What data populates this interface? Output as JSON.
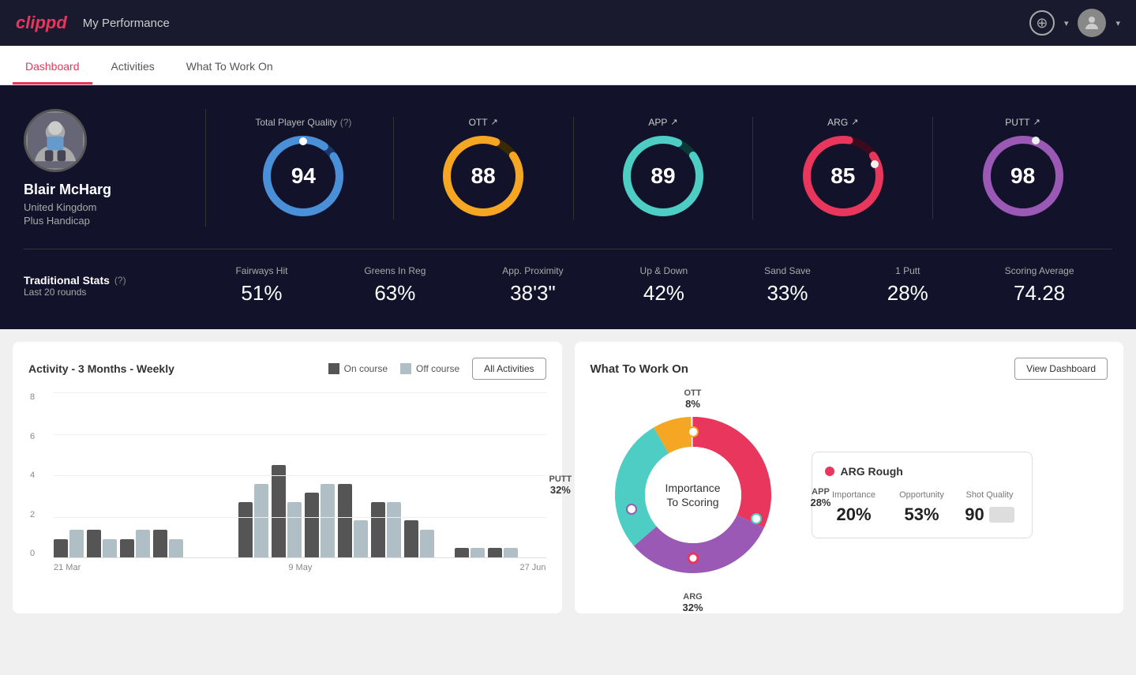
{
  "header": {
    "logo": "clippd",
    "title": "My Performance",
    "add_icon": "+",
    "chevron": "▾"
  },
  "nav": {
    "tabs": [
      {
        "label": "Dashboard",
        "active": true
      },
      {
        "label": "Activities",
        "active": false
      },
      {
        "label": "What To Work On",
        "active": false
      }
    ]
  },
  "player": {
    "name": "Blair McHarg",
    "country": "United Kingdom",
    "handicap": "Plus Handicap"
  },
  "tpq": {
    "label": "Total Player Quality",
    "value": 94,
    "color_start": "#4a90d9",
    "color_end": "#1e5fb5"
  },
  "metrics": [
    {
      "label": "OTT",
      "value": 88,
      "color": "#f5a623"
    },
    {
      "label": "APP",
      "value": 89,
      "color": "#4ecdc4"
    },
    {
      "label": "ARG",
      "value": 85,
      "color": "#e8365d"
    },
    {
      "label": "PUTT",
      "value": 98,
      "color": "#9b59b6"
    }
  ],
  "traditional_stats": {
    "title": "Traditional Stats",
    "subtitle": "Last 20 rounds",
    "items": [
      {
        "label": "Fairways Hit",
        "value": "51%"
      },
      {
        "label": "Greens In Reg",
        "value": "63%"
      },
      {
        "label": "App. Proximity",
        "value": "38'3\""
      },
      {
        "label": "Up & Down",
        "value": "42%"
      },
      {
        "label": "Sand Save",
        "value": "33%"
      },
      {
        "label": "1 Putt",
        "value": "28%"
      },
      {
        "label": "Scoring Average",
        "value": "74.28"
      }
    ]
  },
  "chart": {
    "title": "Activity - 3 Months - Weekly",
    "legend_on": "On course",
    "legend_off": "Off course",
    "all_activities_label": "All Activities",
    "labels": [
      "21 Mar",
      "9 May",
      "27 Jun"
    ],
    "y_labels": [
      "8",
      "6",
      "4",
      "2",
      "0"
    ],
    "bars": [
      {
        "on": 1,
        "off": 1.5
      },
      {
        "on": 1.5,
        "off": 1
      },
      {
        "on": 1,
        "off": 1.5
      },
      {
        "on": 1.5,
        "off": 1
      },
      {
        "on": 0,
        "off": 0
      },
      {
        "on": 0,
        "off": 0
      },
      {
        "on": 0,
        "off": 0
      },
      {
        "on": 3,
        "off": 4
      },
      {
        "on": 5,
        "off": 3
      },
      {
        "on": 3.5,
        "off": 4
      },
      {
        "on": 4,
        "off": 2
      },
      {
        "on": 3,
        "off": 3
      },
      {
        "on": 2,
        "off": 1.5
      },
      {
        "on": 0,
        "off": 0
      },
      {
        "on": 0.5,
        "off": 0.5
      },
      {
        "on": 0.5,
        "off": 0.5
      }
    ]
  },
  "wtwo": {
    "title": "What To Work On",
    "view_dashboard_label": "View Dashboard",
    "donut_center_line1": "Importance",
    "donut_center_line2": "To Scoring",
    "segments": [
      {
        "label": "OTT",
        "percent": "8%",
        "color": "#f5a623"
      },
      {
        "label": "APP",
        "percent": "28%",
        "color": "#4ecdc4"
      },
      {
        "label": "ARG",
        "percent": "32%",
        "color": "#e8365d"
      },
      {
        "label": "PUTT",
        "percent": "32%",
        "color": "#9b59b6"
      }
    ],
    "detail_card": {
      "title": "ARG Rough",
      "dot_color": "#e8365d",
      "importance_label": "Importance",
      "importance_value": "20%",
      "opportunity_label": "Opportunity",
      "opportunity_value": "53%",
      "shot_quality_label": "Shot Quality",
      "shot_quality_value": "90"
    }
  }
}
